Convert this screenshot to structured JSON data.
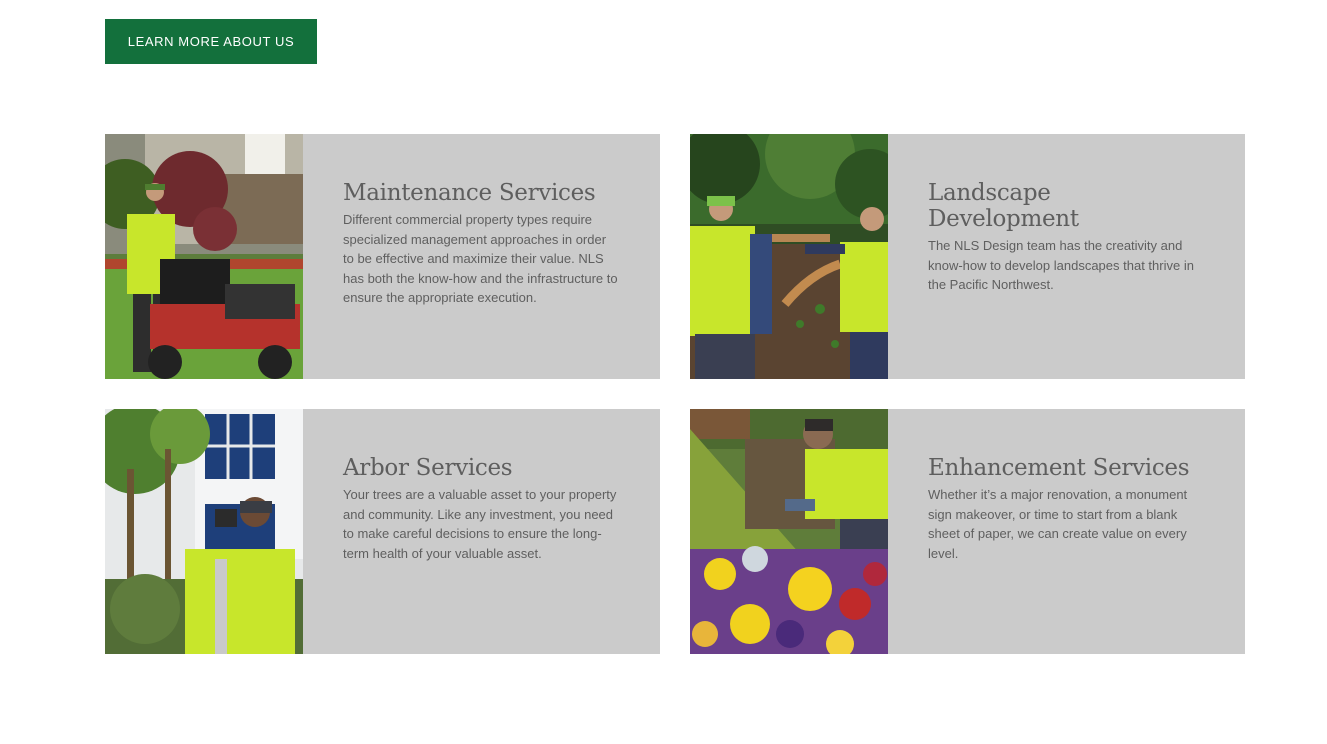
{
  "cta": {
    "label": "LEARN MORE ABOUT US"
  },
  "colors": {
    "brand_green": "#13703c",
    "card_bg": "#cbcbcb",
    "text": "#5f5f5f"
  },
  "services": [
    {
      "title": "Maintenance Services",
      "description": "Different commercial property types require specialized management approaches in order to be effective and maximize their value. NLS has both the know-how and the infrastructure to ensure the appropriate execution.",
      "image": "worker-mowing-lawn-photo"
    },
    {
      "title": "Landscape Development",
      "description": "The NLS Design team has the creativity and know-how to develop landscapes that thrive in the Pacific Northwest.",
      "image": "workers-planting-photo"
    },
    {
      "title": "Arbor Services",
      "description": "Your trees are a valuable asset to your property and community. Like any investment, you need to make careful decisions to ensure the long-term health of your valuable asset.",
      "image": "arborist-photographing-tree-photo"
    },
    {
      "title": "Enhancement Services",
      "description": "Whether it’s a major renovation, a monument sign makeover, or time to start from a blank sheet of paper, we can create value on every level.",
      "image": "worker-planting-flowers-photo"
    }
  ]
}
